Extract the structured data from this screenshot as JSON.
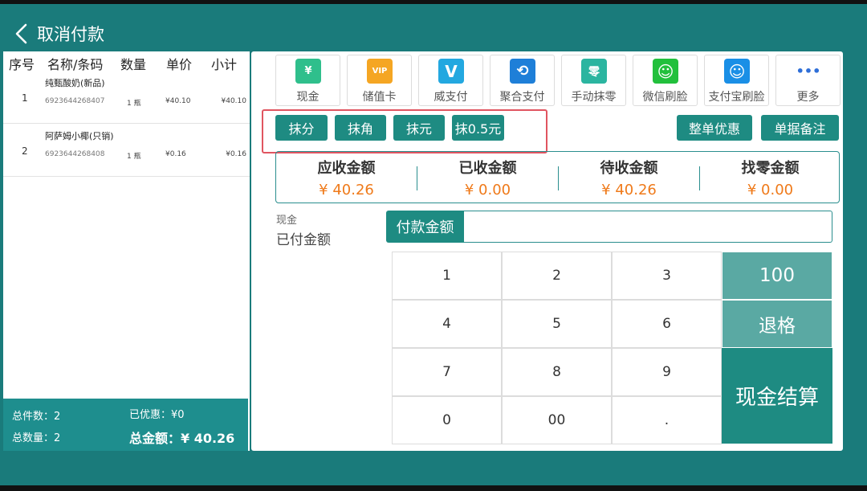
{
  "header": {
    "back_label": "取消付款"
  },
  "order_table": {
    "headers": {
      "seq": "序号",
      "name": "名称/条码",
      "qty": "数量",
      "price": "单价",
      "subtotal": "小计"
    },
    "rows": [
      {
        "seq": "1",
        "name": "纯甄酸奶(新品)",
        "barcode": "6923644268407",
        "qty": "1 瓶",
        "price": "¥40.10",
        "subtotal": "¥40.10"
      },
      {
        "seq": "2",
        "name": "阿萨姆小椰(只销)",
        "barcode": "6923644268408",
        "qty": "1 瓶",
        "price": "¥0.16",
        "subtotal": "¥0.16"
      }
    ]
  },
  "summary": {
    "total_items": "总件数：2",
    "discount": "已优惠：¥0",
    "total_qty": "总数量：2",
    "total_amount": "总金额：¥ 40.26"
  },
  "payment_methods": [
    {
      "label": "现金",
      "icon": "cash-icon",
      "color": "#2fbf8c",
      "glyph": "¥"
    },
    {
      "label": "储值卡",
      "icon": "vip-card-icon",
      "color": "#f5a623",
      "glyph": "VIP"
    },
    {
      "label": "威支付",
      "icon": "wei-pay-icon",
      "color": "#23a8e0",
      "glyph": "V"
    },
    {
      "label": "聚合支付",
      "icon": "aggregate-pay-icon",
      "color": "#1e7fd8",
      "glyph": "⟲"
    },
    {
      "label": "手动抹零",
      "icon": "manual-zero-icon",
      "color": "#2bb5a0",
      "glyph": "零"
    },
    {
      "label": "微信刷脸",
      "icon": "wechat-face-icon",
      "color": "#22c03c",
      "glyph": "☺"
    },
    {
      "label": "支付宝刷脸",
      "icon": "alipay-face-icon",
      "color": "#1a8fe6",
      "glyph": "☺"
    },
    {
      "label": "更多",
      "icon": "more-icon",
      "color": "#2f6fd8",
      "glyph": "•••"
    }
  ],
  "rounding_buttons": [
    "抹分",
    "抹角",
    "抹元",
    "抹0.5元"
  ],
  "order_discount_label": "整单优惠",
  "order_note_label": "单据备注",
  "amounts": {
    "due_label": "应收金额",
    "due_value": "¥ 40.26",
    "received_label": "已收金额",
    "received_value": "¥ 0.00",
    "pending_label": "待收金额",
    "pending_value": "¥ 40.26",
    "change_label": "找零金额",
    "change_value": "¥ 0.00"
  },
  "payment": {
    "method_label": "现金",
    "paid_label": "已付金额",
    "field_label": "付款金额",
    "field_value": ""
  },
  "keypad": {
    "keys": [
      "1",
      "2",
      "3",
      "4",
      "5",
      "6",
      "7",
      "8",
      "9",
      "0",
      "00",
      "."
    ],
    "hundred": "100",
    "backspace": "退格",
    "settle": "现金结算"
  }
}
